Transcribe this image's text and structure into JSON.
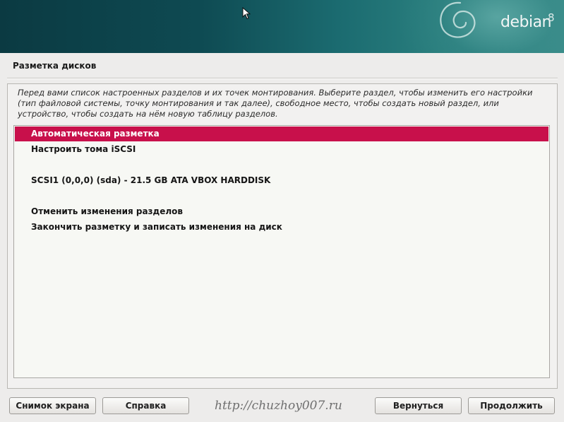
{
  "banner": {
    "brand": "debian",
    "version": "8"
  },
  "page": {
    "title": "Разметка дисков"
  },
  "intro": {
    "text": "Перед вами список настроенных разделов и их точек монтирования. Выберите раздел, чтобы изменить его настройки (тип файловой системы, точку монтирования и так далее), свободное место, чтобы создать новый раздел, или устройство, чтобы создать на нём новую таблицу разделов."
  },
  "list": {
    "items": [
      {
        "label": "Автоматическая разметка",
        "selected": true
      },
      {
        "label": "Настроить тома iSCSI",
        "selected": false
      },
      {
        "label": "SCSI1 (0,0,0) (sda) - 21.5 GB ATA VBOX HARDDISK",
        "selected": false
      },
      {
        "label": "Отменить изменения разделов",
        "selected": false
      },
      {
        "label": "Закончить разметку и записать изменения на диск",
        "selected": false
      }
    ]
  },
  "buttons": {
    "screenshot": "Снимок экрана",
    "help": "Справка",
    "back": "Вернуться",
    "continue": "Продолжить"
  },
  "watermark": "http://chuzhoy007.ru",
  "colors": {
    "selection": "#c8104b",
    "banner_dark": "#0b3a42",
    "banner_light": "#3a8d8a"
  }
}
